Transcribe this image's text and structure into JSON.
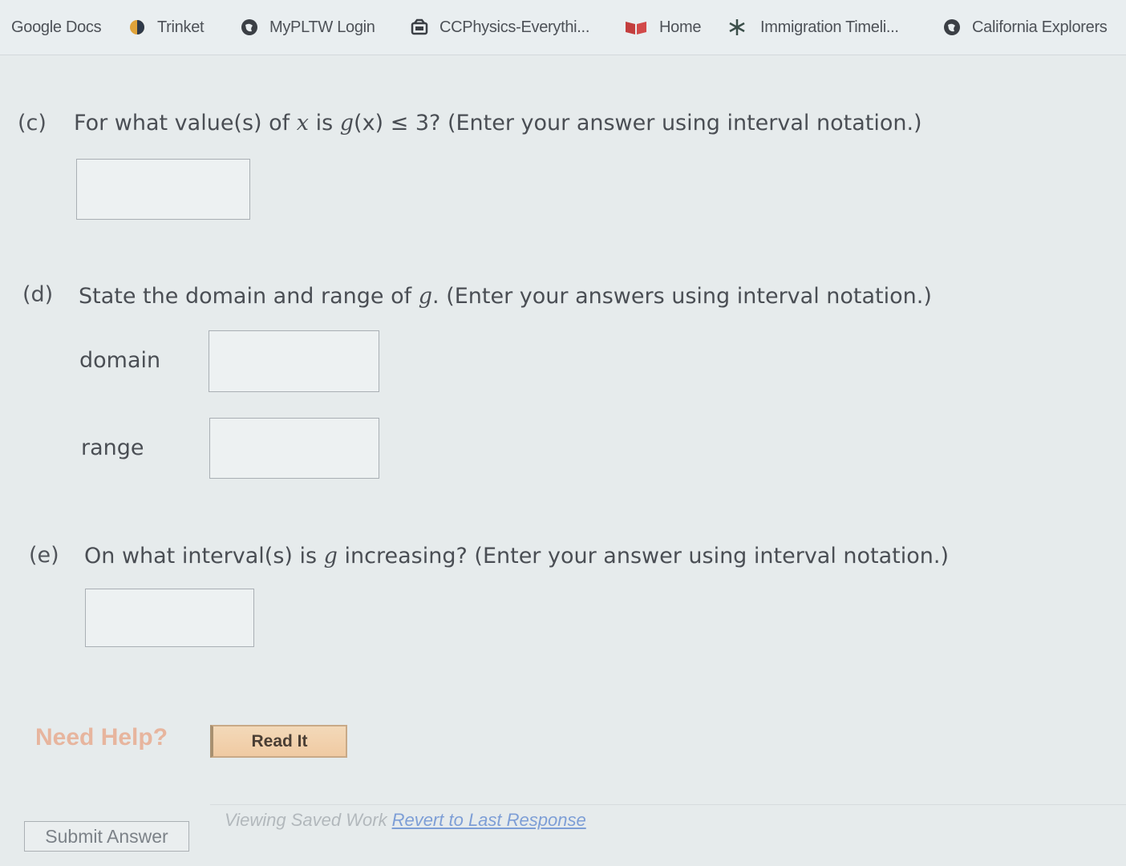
{
  "bookmarks": [
    {
      "label": "Google Docs",
      "icon": "none"
    },
    {
      "label": "Trinket",
      "icon": "trinket-icon"
    },
    {
      "label": "MyPLTW Login",
      "icon": "globe-icon"
    },
    {
      "label": "CCPhysics-Everythi...",
      "icon": "folder-icon"
    },
    {
      "label": "Home",
      "icon": "book-icon"
    },
    {
      "label": "Immigration Timeli...",
      "icon": "snowflake-icon"
    },
    {
      "label": "California Explorers",
      "icon": "globe-icon"
    }
  ],
  "part_c": {
    "label": "(c)",
    "text_before": "For what value(s) of ",
    "var_x": "x",
    "text_is": " is ",
    "func": "g",
    "paren_x": "(x)",
    "text_after": " ≤ 3? (Enter your answer using interval notation.)",
    "answer": ""
  },
  "part_d": {
    "label": "(d)",
    "text_before": "State the domain and range of ",
    "func": "g",
    "text_after": ". (Enter your answers using interval notation.)",
    "domain_label": "domain",
    "domain_answer": "",
    "range_label": "range",
    "range_answer": ""
  },
  "part_e": {
    "label": "(e)",
    "text_before": "On what interval(s) is ",
    "func": "g",
    "text_after": " increasing? (Enter your answer using interval notation.)",
    "answer": ""
  },
  "help": {
    "need_help": "Need Help?",
    "read_it": "Read It"
  },
  "footer": {
    "submit": "Submit Answer",
    "viewing_saved": "Viewing Saved Work",
    "revert": "Revert to Last Response"
  },
  "colors": {
    "need_help": "#e7b59e",
    "read_it_bg": "#f0caa2",
    "link": "#7d9ed6"
  }
}
